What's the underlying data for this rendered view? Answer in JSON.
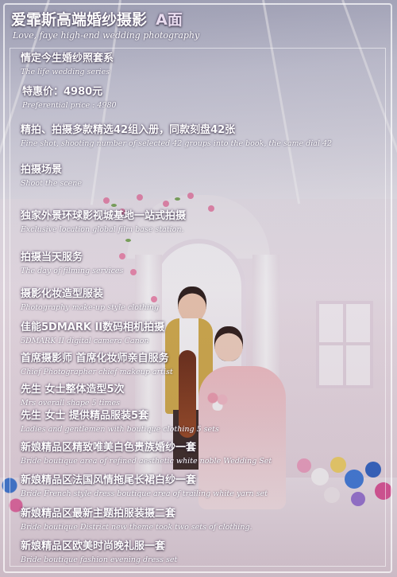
{
  "header": {
    "title": "爱霏斯高端婚纱摄影",
    "title_suffix": "A面",
    "subtitle": "Love, faye high-end wedding photography"
  },
  "items": [
    {
      "cn": "情定今生婚纱照套系",
      "en": "The life wedding series"
    },
    {
      "cn": "特惠价：4980元",
      "en": "Preferential price : 4980"
    },
    {
      "cn": "精拍、拍摄多款精选42组入册，同款刻盘42张",
      "en": "Fine shot, shooting number of selected 42 groups into the book, the same dial 42"
    },
    {
      "cn": "拍摄场景",
      "en": "Shoot the scene"
    },
    {
      "cn": "独家外景环球影视城基地一站式拍摄",
      "en": "Exclusive location global film base station."
    },
    {
      "cn": "拍摄当天服务",
      "en": "The day of filming services"
    },
    {
      "cn": "摄影化妆造型服装",
      "en": "Photography make-up style clothing"
    },
    {
      "cn": "佳能5DMARK II数码相机拍摄",
      "en": "5DMARK II digital camera Canon"
    },
    {
      "cn": "首席摄影师 首席化妆师亲自服务",
      "en": "Chief Photographer chief makeup artist"
    },
    {
      "cn": "先生 女士整体造型5次",
      "en": "Mrs overall shape 5 times"
    },
    {
      "cn": "先生 女士 提供精品服装5套",
      "en": "Ladies and gentlemen with boutique clothing 5 sets"
    },
    {
      "cn": "新娘精品区精致唯美白色贵族婚纱一套",
      "en": "Bride boutique area of refined aesthetic white noble Wedding Set"
    },
    {
      "cn": "新娘精品区法国风情拖尾长裙白纱一套",
      "en": "Bride French style dress boutique area of trailing white yarn set"
    },
    {
      "cn": "新娘精品区最新主题拍服装摄二套",
      "en": "Bride boutique District new theme took two sets of clothing."
    },
    {
      "cn": "新娘精品区欧美时尚晚礼服一套",
      "en": "Bride boutique fashion evening dress set"
    }
  ]
}
